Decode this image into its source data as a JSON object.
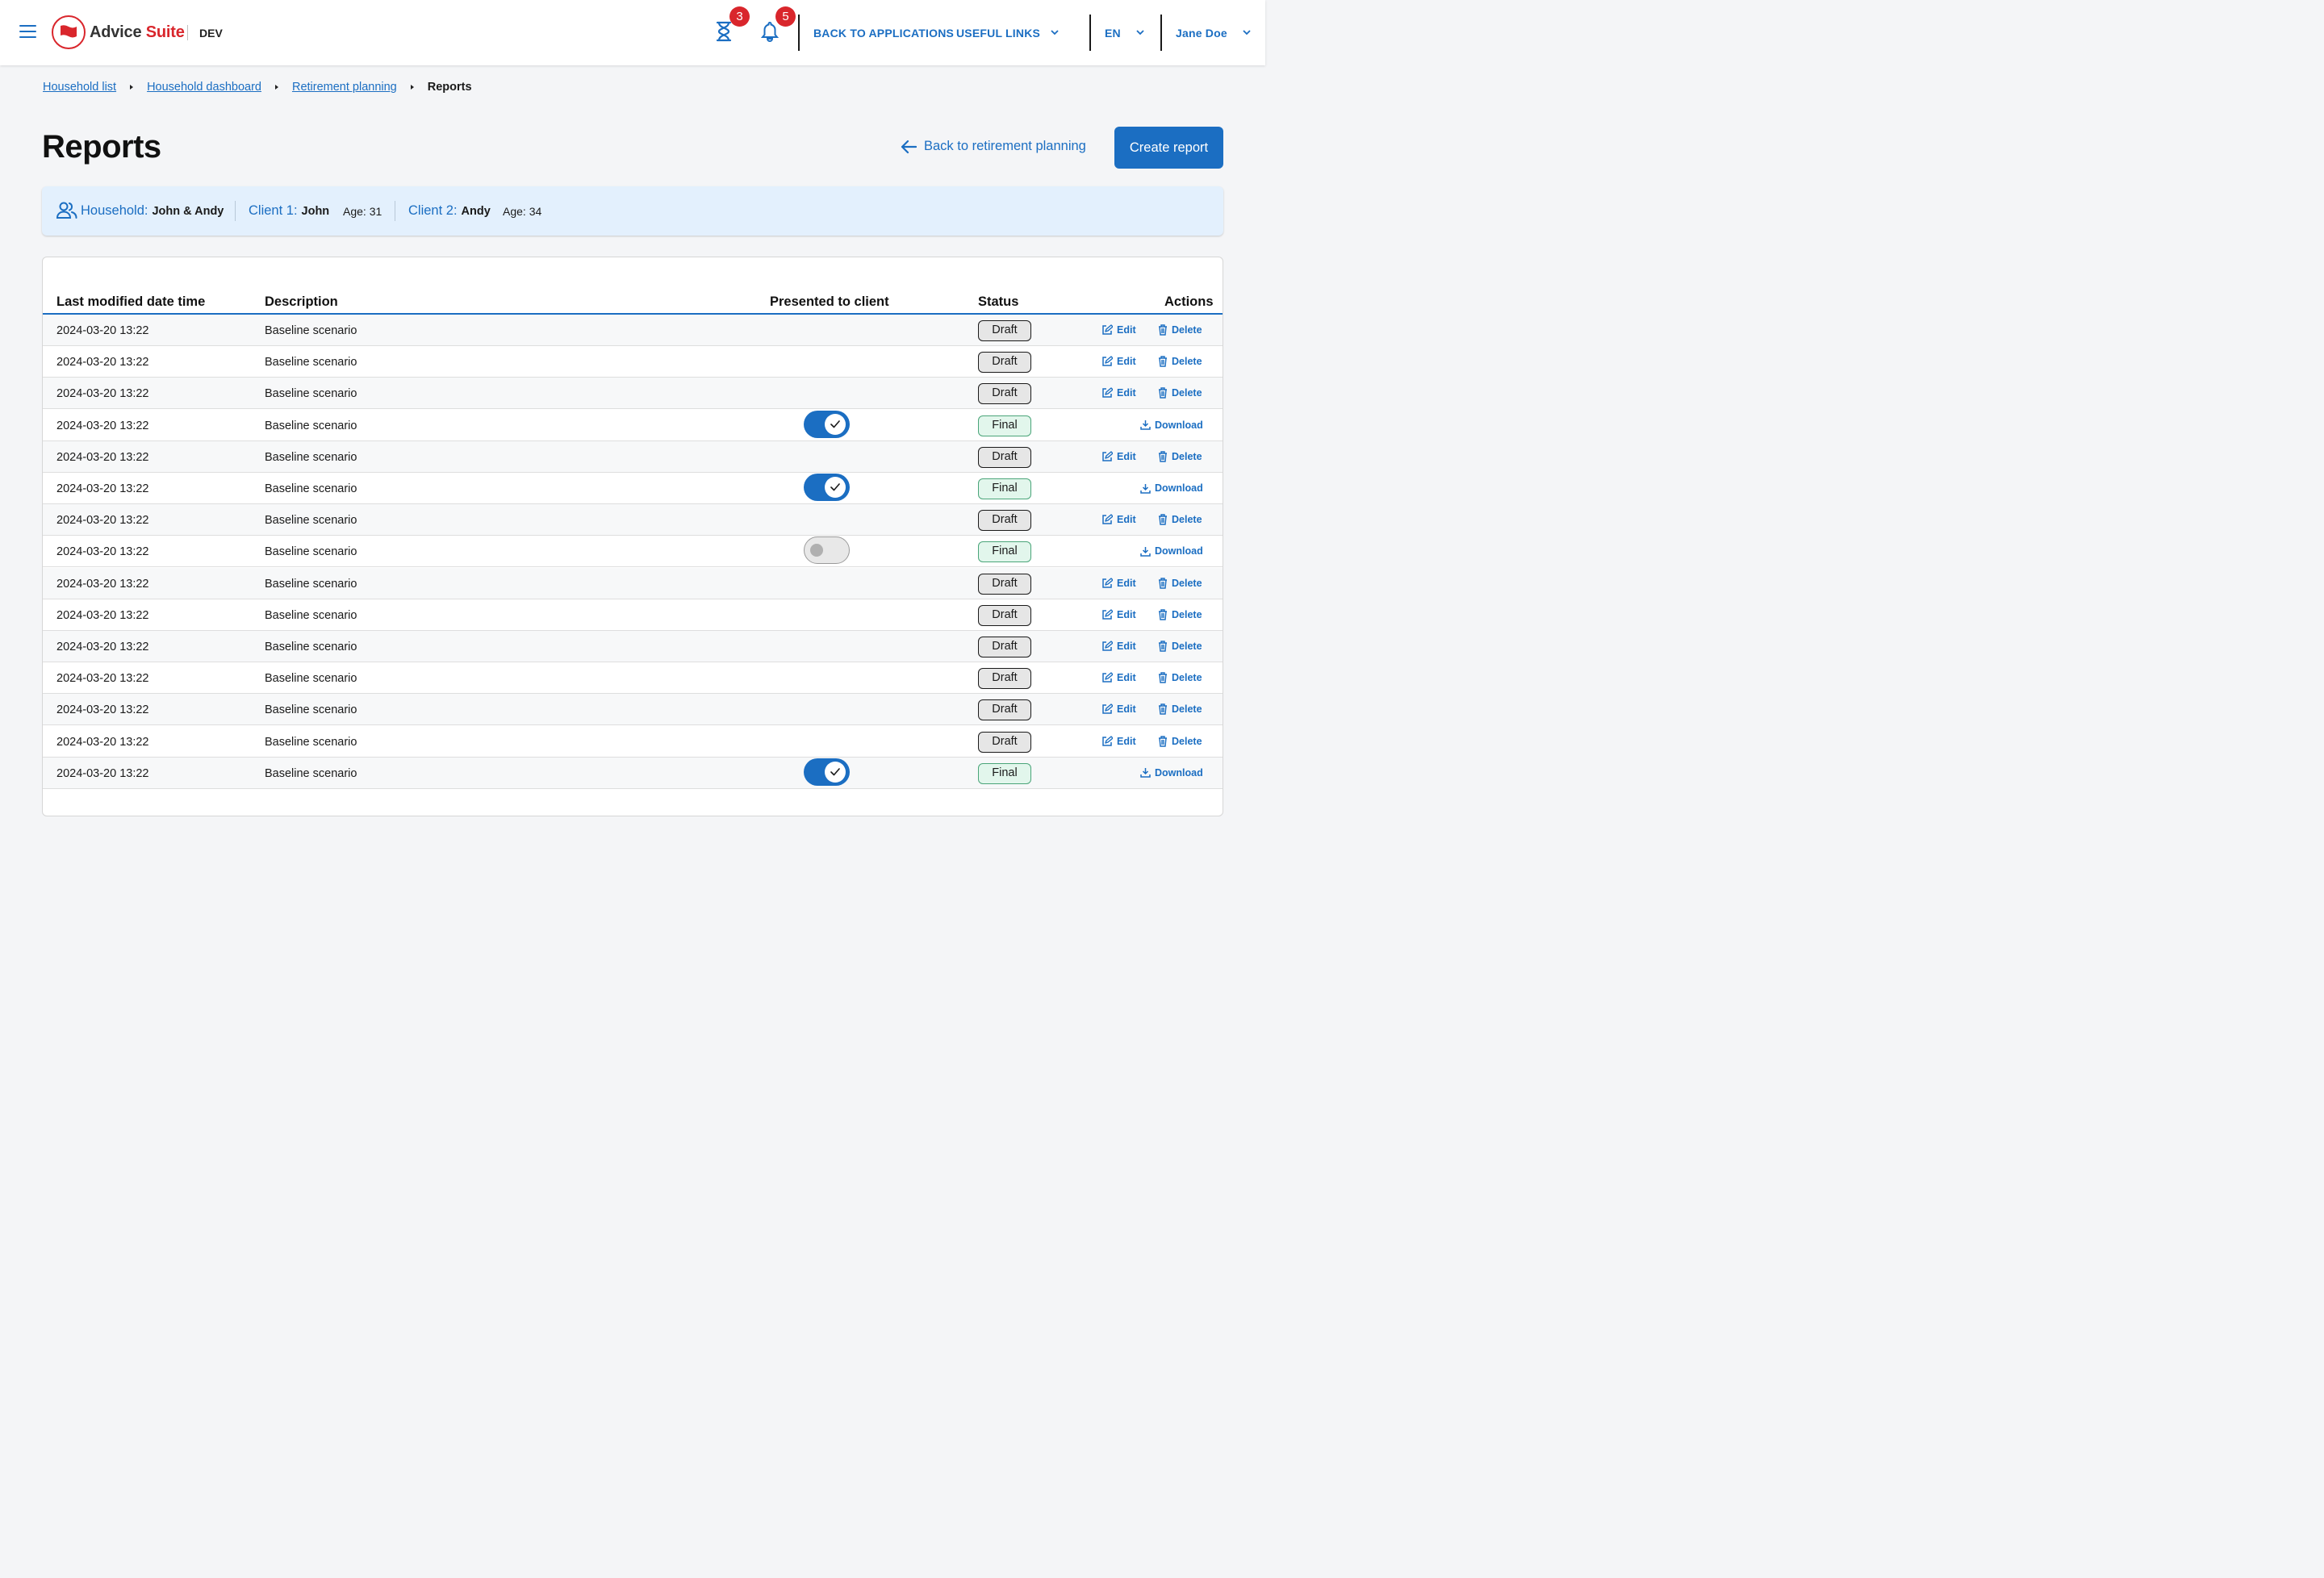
{
  "header": {
    "brand_prefix": "Advice ",
    "brand_suffix": "Suite",
    "env": "DEV",
    "timer_badge": "3",
    "notif_badge": "5",
    "back_to_apps": "BACK TO APPLICATIONS",
    "useful_links": "USEFUL LINKS",
    "language": "EN",
    "user": "Jane Doe",
    "colors": {
      "accent": "#1b6ec2",
      "brand_red": "#d9262c"
    }
  },
  "breadcrumb": {
    "items": [
      "Household list",
      "Household dashboard",
      "Retirement planning"
    ],
    "current": "Reports"
  },
  "page": {
    "title": "Reports",
    "back_link": "Back to retirement planning",
    "create_button": "Create report"
  },
  "household": {
    "household_label": "Household:",
    "household_value": "John & Andy",
    "client1_label": "Client 1:",
    "client1_value": "John",
    "client1_age": "Age: 31",
    "client2_label": "Client 2:",
    "client2_value": "Andy",
    "client2_age": "Age: 34"
  },
  "table": {
    "columns": [
      "Last modified date time",
      "Description",
      "Presented to client",
      "Status",
      "Actions"
    ],
    "actions": {
      "edit": "Edit",
      "delete": "Delete",
      "download": "Download"
    },
    "rows": [
      {
        "date": "2024-03-20 13:22",
        "description": "Baseline scenario",
        "status": "Draft",
        "presented": null
      },
      {
        "date": "2024-03-20 13:22",
        "description": "Baseline scenario",
        "status": "Draft",
        "presented": null
      },
      {
        "date": "2024-03-20 13:22",
        "description": "Baseline scenario",
        "status": "Draft",
        "presented": null
      },
      {
        "date": "2024-03-20 13:22",
        "description": "Baseline scenario",
        "status": "Final",
        "presented": true
      },
      {
        "date": "2024-03-20 13:22",
        "description": "Baseline scenario",
        "status": "Draft",
        "presented": null
      },
      {
        "date": "2024-03-20 13:22",
        "description": "Baseline scenario",
        "status": "Final",
        "presented": true
      },
      {
        "date": "2024-03-20 13:22",
        "description": "Baseline scenario",
        "status": "Draft",
        "presented": null
      },
      {
        "date": "2024-03-20 13:22",
        "description": "Baseline scenario",
        "status": "Final",
        "presented": false
      },
      {
        "date": "2024-03-20 13:22",
        "description": "Baseline scenario",
        "status": "Draft",
        "presented": null
      },
      {
        "date": "2024-03-20 13:22",
        "description": "Baseline scenario",
        "status": "Draft",
        "presented": null
      },
      {
        "date": "2024-03-20 13:22",
        "description": "Baseline scenario",
        "status": "Draft",
        "presented": null
      },
      {
        "date": "2024-03-20 13:22",
        "description": "Baseline scenario",
        "status": "Draft",
        "presented": null
      },
      {
        "date": "2024-03-20 13:22",
        "description": "Baseline scenario",
        "status": "Draft",
        "presented": null
      },
      {
        "date": "2024-03-20 13:22",
        "description": "Baseline scenario",
        "status": "Draft",
        "presented": null
      },
      {
        "date": "2024-03-20 13:22",
        "description": "Baseline scenario",
        "status": "Final",
        "presented": true
      }
    ]
  }
}
